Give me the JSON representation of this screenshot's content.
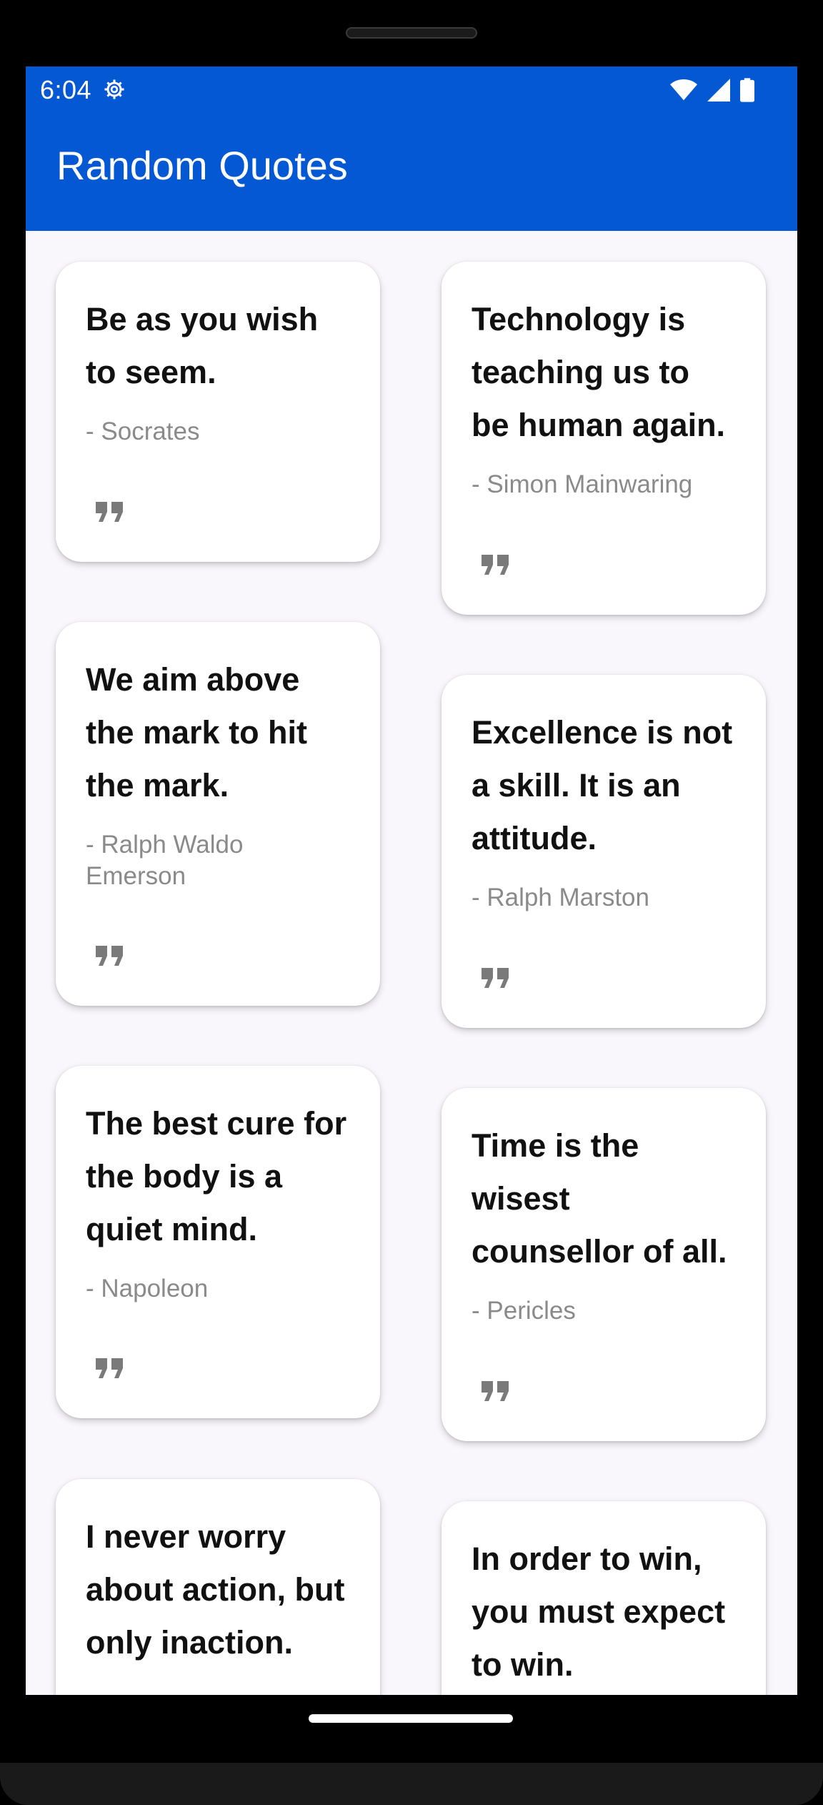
{
  "status_bar": {
    "time": "6:04",
    "icons": [
      "settings-gear-icon",
      "wifi-icon",
      "cell-signal-icon",
      "battery-icon"
    ]
  },
  "app_bar": {
    "title": "Random Quotes",
    "color": "#0558d4"
  },
  "quotes": [
    {
      "text": "Be as you wish to seem.",
      "author": "- Socrates"
    },
    {
      "text": "Technology is teaching us to be human again.",
      "author": "- Simon Mainwaring"
    },
    {
      "text": "We aim above the mark to hit the mark.",
      "author": "- Ralph Waldo Emerson"
    },
    {
      "text": "Excellence is not a skill. It is an attitude.",
      "author": "- Ralph Marston"
    },
    {
      "text": "The best cure for the body is a quiet mind.",
      "author": "- Napoleon"
    },
    {
      "text": "Time is the wisest counsellor of all.",
      "author": "- Pericles"
    },
    {
      "text": "I never worry about action, but only inaction.",
      "author": ""
    },
    {
      "text": "In order to win, you must expect to win.",
      "author": ""
    }
  ],
  "colors": {
    "accent": "#0558d4",
    "background": "#f9f7fb",
    "card": "#ffffff",
    "author_text": "#8a8a8a",
    "quote_icon": "#7a7a7a"
  }
}
